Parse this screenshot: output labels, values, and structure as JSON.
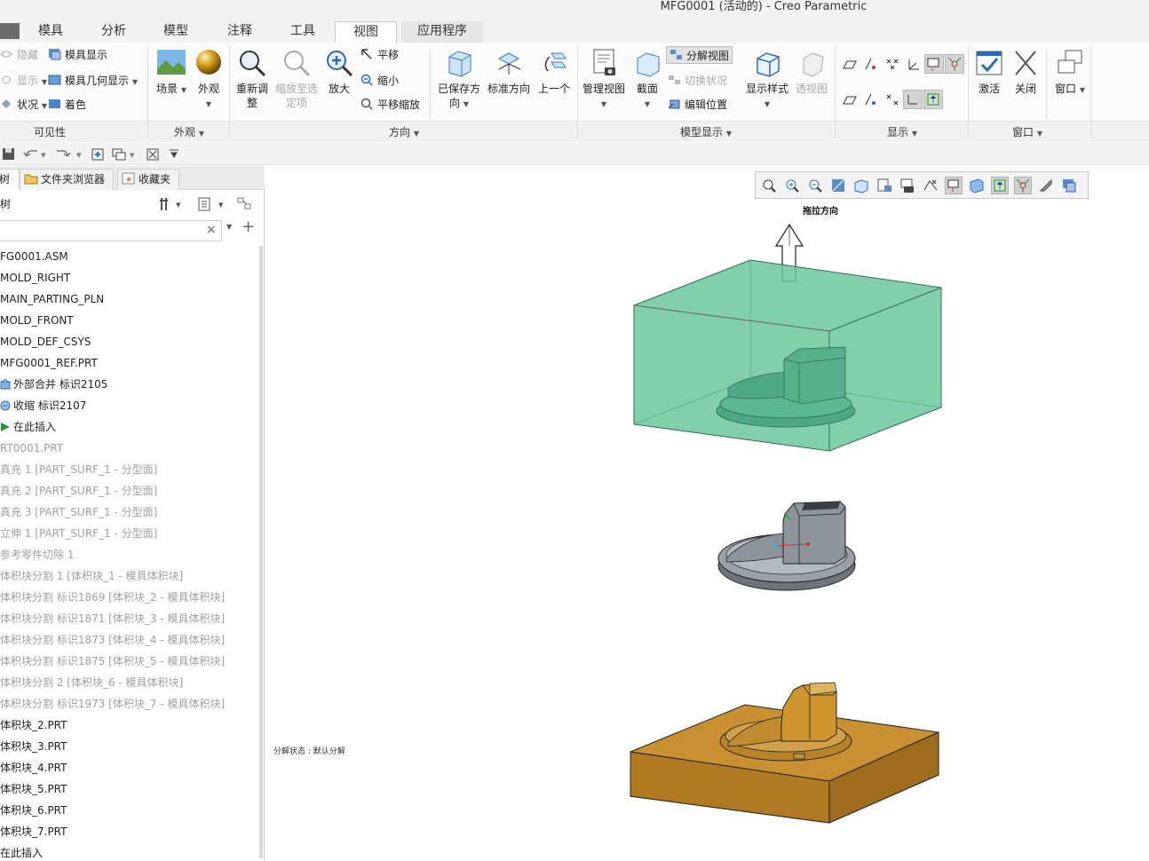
{
  "window": {
    "title": "MFG0001 (活动的) - Creo Parametric"
  },
  "tabs": [
    {
      "label": "模具"
    },
    {
      "label": "分析"
    },
    {
      "label": "模型"
    },
    {
      "label": "注释"
    },
    {
      "label": "工具"
    },
    {
      "label": "视图",
      "active": true
    },
    {
      "label": "应用程序"
    }
  ],
  "ribbon": {
    "visibility": {
      "hide": "隐藏",
      "show": "显示",
      "status": "状况",
      "mold_display": "模具显示",
      "mold_geom_display": "模具几何显示",
      "color": "着色",
      "group_label": "可见性"
    },
    "appearance": {
      "scene": "场景",
      "look": "外观",
      "group_label": "外观"
    },
    "orientation": {
      "refit_1": "重新调",
      "refit_2": "整",
      "zoom_sel_1": "缩放至选",
      "zoom_sel_2": "定项",
      "zoom_in": "放大",
      "pan": "平移",
      "zoom_out": "缩小",
      "pan_zoom": "平移缩放",
      "saved_1": "已保存方",
      "saved_2": "向",
      "standard": "标准方向",
      "previous": "上一个",
      "group_label": "方向"
    },
    "model_display": {
      "manage_views": "管理视图",
      "section": "截面",
      "explode": "分解视图",
      "toggle_status": "切换状况",
      "edit_position": "编辑位置",
      "display_style": "显示样式",
      "perspective": "透视图",
      "group_label": "模型显示"
    },
    "show": {
      "group_label": "显示"
    },
    "window_grp": {
      "activate": "激活",
      "close": "关闭",
      "window": "窗口",
      "group_label": "窗口"
    }
  },
  "panel": {
    "tabs": {
      "model_tree": "树",
      "folder_browser": "文件夹浏览器",
      "favorites": "收藏夹"
    },
    "header_label": "树",
    "search_clear": "×"
  },
  "tree": [
    {
      "label": "FG0001.ASM",
      "dim": false,
      "icon": "none"
    },
    {
      "label": "MOLD_RIGHT",
      "dim": false,
      "icon": "none"
    },
    {
      "label": "MAIN_PARTING_PLN",
      "dim": false,
      "icon": "none"
    },
    {
      "label": "MOLD_FRONT",
      "dim": false,
      "icon": "none"
    },
    {
      "label": "MOLD_DEF_CSYS",
      "dim": false,
      "icon": "none"
    },
    {
      "label": "MFG0001_REF.PRT",
      "dim": false,
      "icon": "none"
    },
    {
      "label": "外部合并 标识2105",
      "dim": false,
      "icon": "merge-icon"
    },
    {
      "label": "收缩 标识2107",
      "dim": false,
      "icon": "shrink-icon"
    },
    {
      "label": "在此插入",
      "dim": false,
      "icon": "insert-arrow-icon"
    },
    {
      "label": "RT0001.PRT",
      "dim": true,
      "icon": "none"
    },
    {
      "label": "真充 1 [PART_SURF_1 - 分型面]",
      "dim": true,
      "icon": "none"
    },
    {
      "label": "真充 2 [PART_SURF_1 - 分型面]",
      "dim": true,
      "icon": "none"
    },
    {
      "label": "真充 3 [PART_SURF_1 - 分型面]",
      "dim": true,
      "icon": "none"
    },
    {
      "label": "立伸 1 [PART_SURF_1 - 分型面]",
      "dim": true,
      "icon": "none"
    },
    {
      "label": "参考零件切除 1",
      "dim": true,
      "icon": "none"
    },
    {
      "label": "体积块分割 1 [体积块_1 - 模具体积块]",
      "dim": true,
      "icon": "none"
    },
    {
      "label": "体积块分割 标识1869 [体积块_2 - 模具体积块]",
      "dim": true,
      "icon": "none"
    },
    {
      "label": "体积块分割 标识1871 [体积块_3 - 模具体积块]",
      "dim": true,
      "icon": "none"
    },
    {
      "label": "体积块分割 标识1873 [体积块_4 - 模具体积块]",
      "dim": true,
      "icon": "none"
    },
    {
      "label": "体积块分割 标识1875 [体积块_5 - 模具体积块]",
      "dim": true,
      "icon": "none"
    },
    {
      "label": "体积块分割 2 [体积块_6 - 模具体积块]",
      "dim": true,
      "icon": "none"
    },
    {
      "label": "体积块分割 标识1973 [体积块_7 - 模具体积块]",
      "dim": true,
      "icon": "none"
    },
    {
      "label": "体积块_2.PRT",
      "dim": false,
      "icon": "none"
    },
    {
      "label": "体积块_3.PRT",
      "dim": false,
      "icon": "none"
    },
    {
      "label": "体积块_4.PRT",
      "dim": false,
      "icon": "none"
    },
    {
      "label": "体积块_5.PRT",
      "dim": false,
      "icon": "none"
    },
    {
      "label": "体积块_6.PRT",
      "dim": false,
      "icon": "none"
    },
    {
      "label": "体积块_7.PRT",
      "dim": false,
      "icon": "none"
    },
    {
      "label": "在此插入",
      "dim": false,
      "icon": "none"
    }
  ],
  "graphics": {
    "pull_direction_label": "拖拉方向",
    "explode_status_label": "分解状态 : 默认分解"
  },
  "colors": {
    "mold_box": "#6cc79e",
    "part_gray": "#8e959d",
    "cavity_gold": "#c89030"
  }
}
